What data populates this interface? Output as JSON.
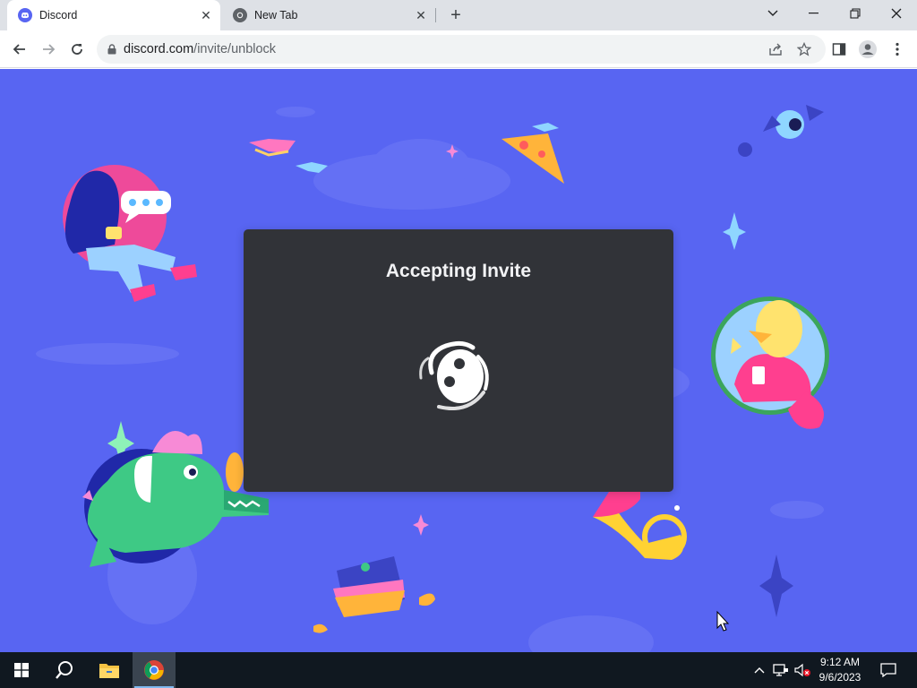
{
  "browser": {
    "tabs": [
      {
        "title": "Discord",
        "active": true
      },
      {
        "title": "New Tab",
        "active": false
      }
    ],
    "new_tab_symbol": "+",
    "address": {
      "host": "discord.com",
      "path": "/invite/unblock"
    },
    "icons": {
      "back": "back-arrow-icon",
      "forward": "forward-arrow-icon",
      "reload": "reload-icon",
      "lock": "lock-icon",
      "share": "share-icon",
      "bookmark": "star-icon",
      "sidepanel": "side-panel-icon",
      "profile": "profile-icon",
      "menu": "kebab-menu-icon"
    }
  },
  "modal": {
    "title": "Accepting Invite"
  },
  "taskbar": {
    "time": "9:12 AM",
    "date": "9/6/2023"
  },
  "colors": {
    "page_bg": "#5865f2",
    "modal_bg": "#313338",
    "taskbar_bg": "#101820"
  }
}
